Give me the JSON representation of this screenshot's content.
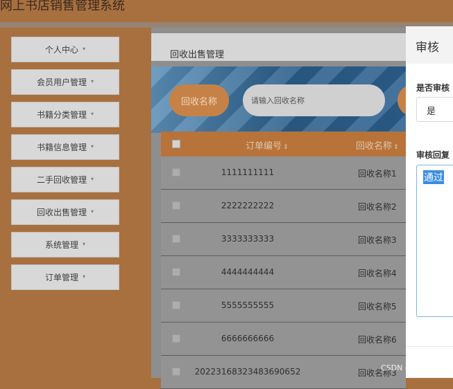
{
  "app": {
    "title": "网上书店销售管理系统"
  },
  "sidebar": {
    "items": [
      {
        "label": "个人中心"
      },
      {
        "label": "会员用户管理"
      },
      {
        "label": "书籍分类管理"
      },
      {
        "label": "书籍信息管理"
      },
      {
        "label": "二手回收管理"
      },
      {
        "label": "回收出售管理"
      },
      {
        "label": "系统管理"
      },
      {
        "label": "订单管理"
      }
    ],
    "chevron": "▾"
  },
  "main": {
    "breadcrumb": "回收出售管理",
    "search": {
      "label": "回收名称",
      "placeholder": "请输入回收名称"
    },
    "table": {
      "columns": [
        "订单编号",
        "回收名称"
      ],
      "sort_icon": "⇕",
      "rows": [
        {
          "order_no": "1111111111",
          "name": "回收名称1"
        },
        {
          "order_no": "2222222222",
          "name": "回收名称2"
        },
        {
          "order_no": "3333333333",
          "name": "回收名称3"
        },
        {
          "order_no": "4444444444",
          "name": "回收名称4"
        },
        {
          "order_no": "5555555555",
          "name": "回收名称5"
        },
        {
          "order_no": "6666666666",
          "name": "回收名称6"
        },
        {
          "order_no": "20223168323483690652",
          "name": "回收名称3"
        }
      ]
    }
  },
  "dialog": {
    "title": "审核",
    "approve_label": "是否审核",
    "approve_value": "是",
    "reply_label": "审核回复",
    "reply_value": "通过"
  },
  "watermark": "CSDN @雪石网络",
  "colors": {
    "accent": "#a8703f",
    "header_accent": "#b7733a",
    "selection": "#3b8ce2"
  }
}
